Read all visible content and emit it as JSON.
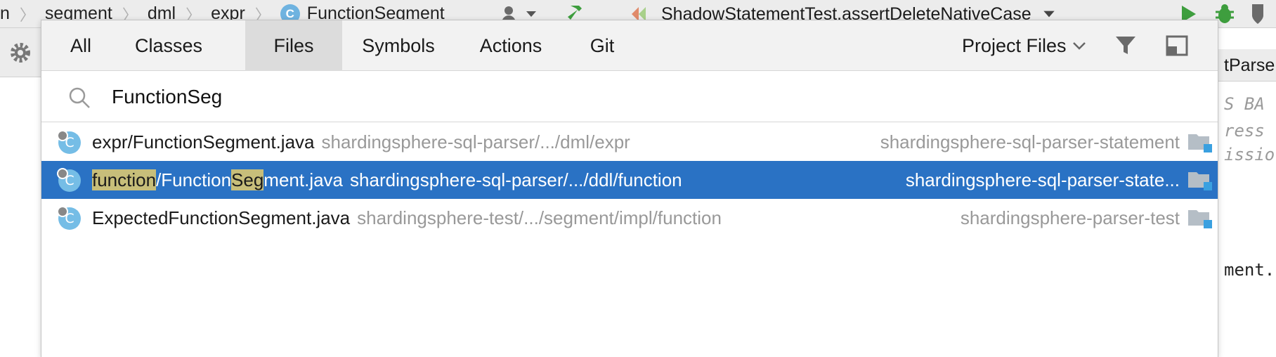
{
  "ide": {
    "breadcrumbs": [
      "n",
      "segment",
      "dml",
      "expr",
      "FunctionSegment"
    ],
    "run_config": "ShadowStatementTest.assertDeleteNativeCase",
    "right_tab_label": "tParse",
    "code_lines": [
      "S  BA",
      "ress",
      "issio",
      "ment."
    ]
  },
  "popup": {
    "tabs": [
      {
        "label": "All"
      },
      {
        "label": "Classes"
      },
      {
        "label": "Files"
      },
      {
        "label": "Symbols"
      },
      {
        "label": "Actions"
      },
      {
        "label": "Git"
      }
    ],
    "active_tab": "Files",
    "scope_label": "Project Files",
    "search": {
      "value": "FunctionSeg"
    },
    "results": [
      {
        "dir": "expr",
        "name": "/FunctionSegment.java",
        "path": "shardingsphere-sql-parser/.../dml/expr",
        "module": "shardingsphere-sql-parser-statement",
        "selected": false
      },
      {
        "dir": "function",
        "name_pre": "/Function",
        "name_hl": "Seg",
        "name_post": "ment.java",
        "path": "shardingsphere-sql-parser/.../ddl/function",
        "module": "shardingsphere-sql-parser-state...",
        "selected": true
      },
      {
        "name": "ExpectedFunctionSegment.java",
        "path": "shardingsphere-test/.../segment/impl/function",
        "module": "shardingsphere-parser-test",
        "selected": false
      }
    ]
  },
  "colors": {
    "selection": "#2a72c4",
    "match_highlight": "#c7be7a",
    "class_icon": "#75bde6",
    "run_green": "#3e9e3e"
  },
  "icons": {
    "c_icon_letter": "C",
    "search": "search-icon",
    "filter": "filter-icon",
    "pin": "pin-window-icon",
    "folder": "module-folder-icon"
  }
}
